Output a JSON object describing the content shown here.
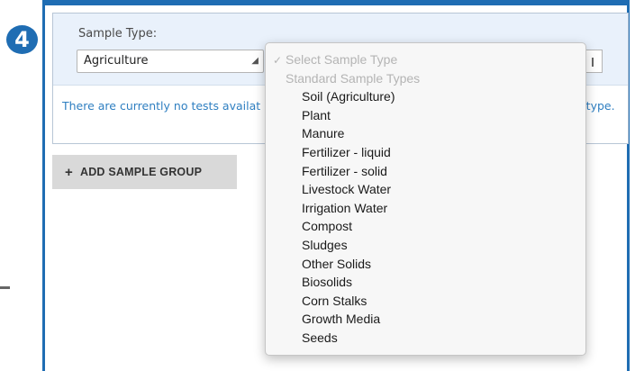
{
  "step": {
    "number": "4"
  },
  "form": {
    "sample_type_label": "Sample Type:",
    "selected_value": "Agriculture",
    "message_start": "There are currently no tests availat",
    "message_end": "e type."
  },
  "actions": {
    "add_group_label": "ADD SAMPLE GROUP"
  },
  "dropdown": {
    "placeholder": "Select Sample Type",
    "group_label": "Standard Sample Types",
    "options": [
      "Soil (Agriculture)",
      "Plant",
      "Manure",
      "Fertilizer - liquid",
      "Fertilizer - solid",
      "Livestock Water",
      "Irrigation Water",
      "Compost",
      "Sludges",
      "Other Solids",
      "Biosolids",
      "Corn Stalks",
      "Growth Media",
      "Seeds"
    ]
  },
  "colors": {
    "accent": "#1f6db3",
    "link": "#2f7fc1",
    "panel_bg": "#e9f1fb"
  }
}
